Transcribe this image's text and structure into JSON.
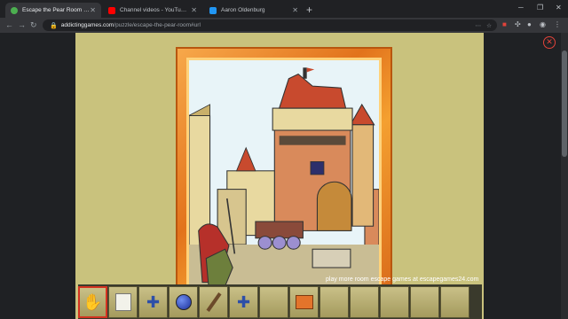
{
  "tabs": [
    {
      "title": "Escape the Pear Room | Addicti",
      "color": "#4caf50",
      "active": true
    },
    {
      "title": "Channel videos - YouTube Studio",
      "color": "#ff0000",
      "active": false
    },
    {
      "title": "Aaron Oldenburg",
      "color": "#2196f3",
      "active": false
    }
  ],
  "url": {
    "host": "addictinggames.com",
    "path": "/puzzle/escape-the-pear-room#url"
  },
  "game": {
    "promo_text": "play more room escape games at escapegames24.com",
    "inventory": [
      "hand-icon",
      "paper-icon",
      "puzzle-piece-icon",
      "ornament-ball-icon",
      "stick-icon",
      "puzzle-piece-icon",
      "empty",
      "gift-box-icon",
      "empty",
      "empty",
      "empty",
      "empty",
      "empty"
    ]
  }
}
